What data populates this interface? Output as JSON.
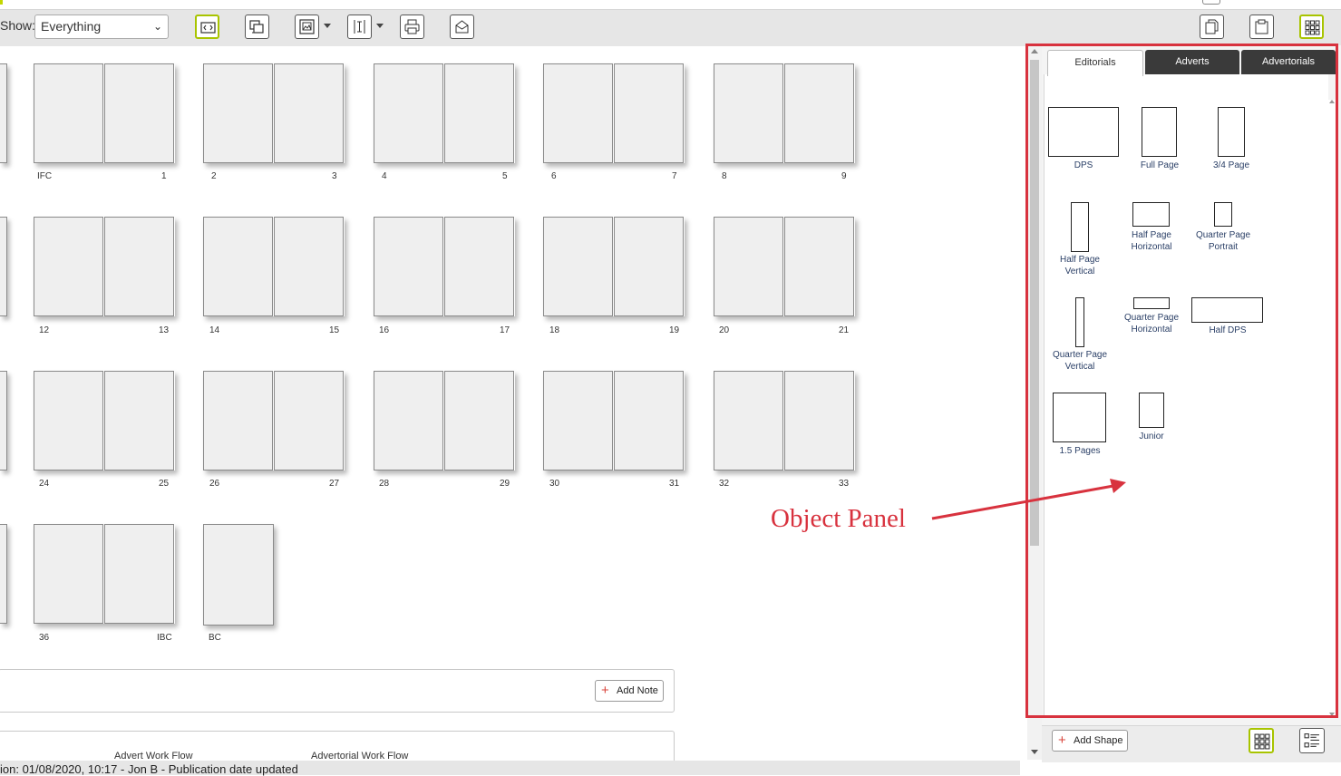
{
  "toolbar": {
    "show_label": "Show:",
    "show_value": "Everything",
    "buttons": [
      {
        "name": "fit-view-icon",
        "active": true
      },
      {
        "name": "layers-icon",
        "active": false
      },
      {
        "name": "image-icon",
        "active": false,
        "dropdown": true
      },
      {
        "name": "column-width-icon",
        "active": false,
        "dropdown": true
      },
      {
        "name": "print-icon",
        "active": false
      },
      {
        "name": "email-icon",
        "active": false
      }
    ],
    "right_buttons": [
      {
        "name": "copy-pages-icon",
        "active": false
      },
      {
        "name": "clipboard-icon",
        "active": false
      },
      {
        "name": "grid-view-icon",
        "active": true
      }
    ]
  },
  "flatplan": {
    "rows": [
      {
        "spreads": [
          [
            "IFC",
            "1"
          ],
          [
            "2",
            "3"
          ],
          [
            "4",
            "5"
          ],
          [
            "6",
            "7"
          ],
          [
            "8",
            "9"
          ]
        ]
      },
      {
        "spreads": [
          [
            "12",
            "13"
          ],
          [
            "14",
            "15"
          ],
          [
            "16",
            "17"
          ],
          [
            "18",
            "19"
          ],
          [
            "20",
            "21"
          ]
        ]
      },
      {
        "spreads": [
          [
            "24",
            "25"
          ],
          [
            "26",
            "27"
          ],
          [
            "28",
            "29"
          ],
          [
            "30",
            "31"
          ],
          [
            "32",
            "33"
          ]
        ]
      },
      {
        "spreads": [
          [
            "36",
            "IBC"
          ],
          [
            "BC"
          ]
        ]
      }
    ]
  },
  "notes": {
    "add_note_label": "Add Note"
  },
  "workflows": {
    "advert": "Advert Work Flow",
    "advertorial": "Advertorial Work Flow"
  },
  "status": {
    "text": "ion: 01/08/2020, 10:17 - Jon B - Publication date updated"
  },
  "object_panel": {
    "tabs": [
      {
        "label": "Editorials",
        "active": true
      },
      {
        "label": "Adverts",
        "active": false
      },
      {
        "label": "Advertorials",
        "active": false
      }
    ],
    "shapes": [
      {
        "label": "DPS"
      },
      {
        "label": "Full Page"
      },
      {
        "label": "3/4 Page"
      },
      {
        "label": "Half Page Vertical"
      },
      {
        "label": "Half Page Horizontal"
      },
      {
        "label": "Quarter Page Portrait"
      },
      {
        "label": "Quarter Page Vertical"
      },
      {
        "label": "Quarter Page Horizontal"
      },
      {
        "label": "Half DPS"
      },
      {
        "label": "1.5 Pages"
      },
      {
        "label": "Junior"
      }
    ],
    "add_shape_label": "Add Shape",
    "view_buttons": [
      {
        "name": "grid-view-icon",
        "active": true
      },
      {
        "name": "list-view-icon",
        "active": false
      }
    ]
  },
  "annotation": {
    "text": "Object Panel",
    "color": "#d8323e"
  },
  "colors": {
    "accent": "#a8c400",
    "highlight": "#d8323e",
    "tab_dark": "#3a3a3a"
  }
}
